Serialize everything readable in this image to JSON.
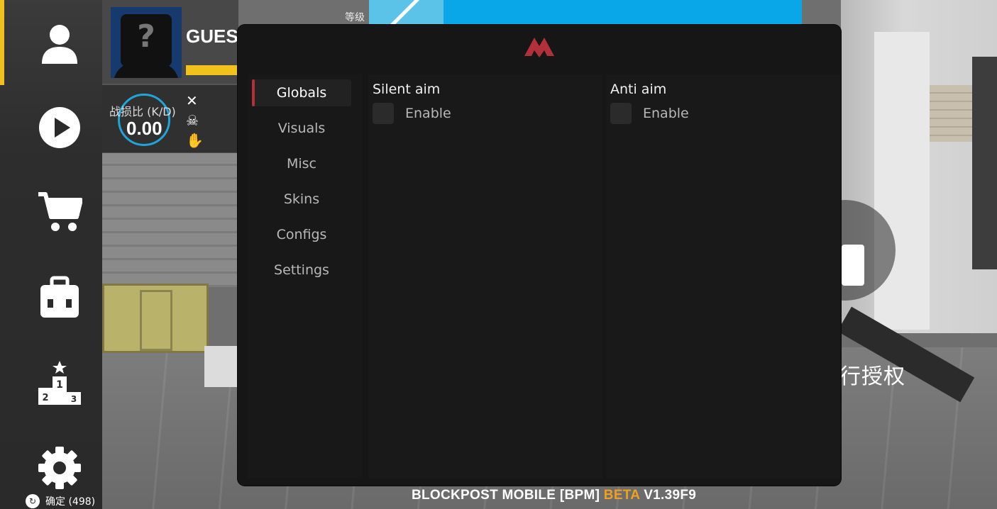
{
  "background": {
    "level_label": "等级",
    "right_text": "行授权"
  },
  "rail": {
    "items": [
      {
        "icon": "profile-icon"
      },
      {
        "icon": "play-icon"
      },
      {
        "icon": "shop-cart-icon"
      },
      {
        "icon": "inventory-backpack-icon"
      },
      {
        "icon": "leaderboard-podium-icon"
      },
      {
        "icon": "settings-gear-icon"
      }
    ],
    "footer_label": "确定 (498)"
  },
  "profile": {
    "name": "GUEST",
    "kd_label": "战损比 (K/D)",
    "kd_value": "0.00"
  },
  "menu": {
    "tabs": [
      {
        "label": "Globals",
        "active": true
      },
      {
        "label": "Visuals",
        "active": false
      },
      {
        "label": "Misc",
        "active": false
      },
      {
        "label": "Skins",
        "active": false
      },
      {
        "label": "Configs",
        "active": false
      },
      {
        "label": "Settings",
        "active": false
      }
    ],
    "sections": [
      {
        "title": "Silent aim",
        "option": "Enable",
        "checked": false
      },
      {
        "title": "Anti aim",
        "option": "Enable",
        "checked": false
      }
    ],
    "accent_color": "#b3303a"
  },
  "footer": {
    "version_prefix": "BLOCKPOST MOBILE [BPM]",
    "version_beta": "BETA",
    "version_number": "V1.39F9"
  }
}
